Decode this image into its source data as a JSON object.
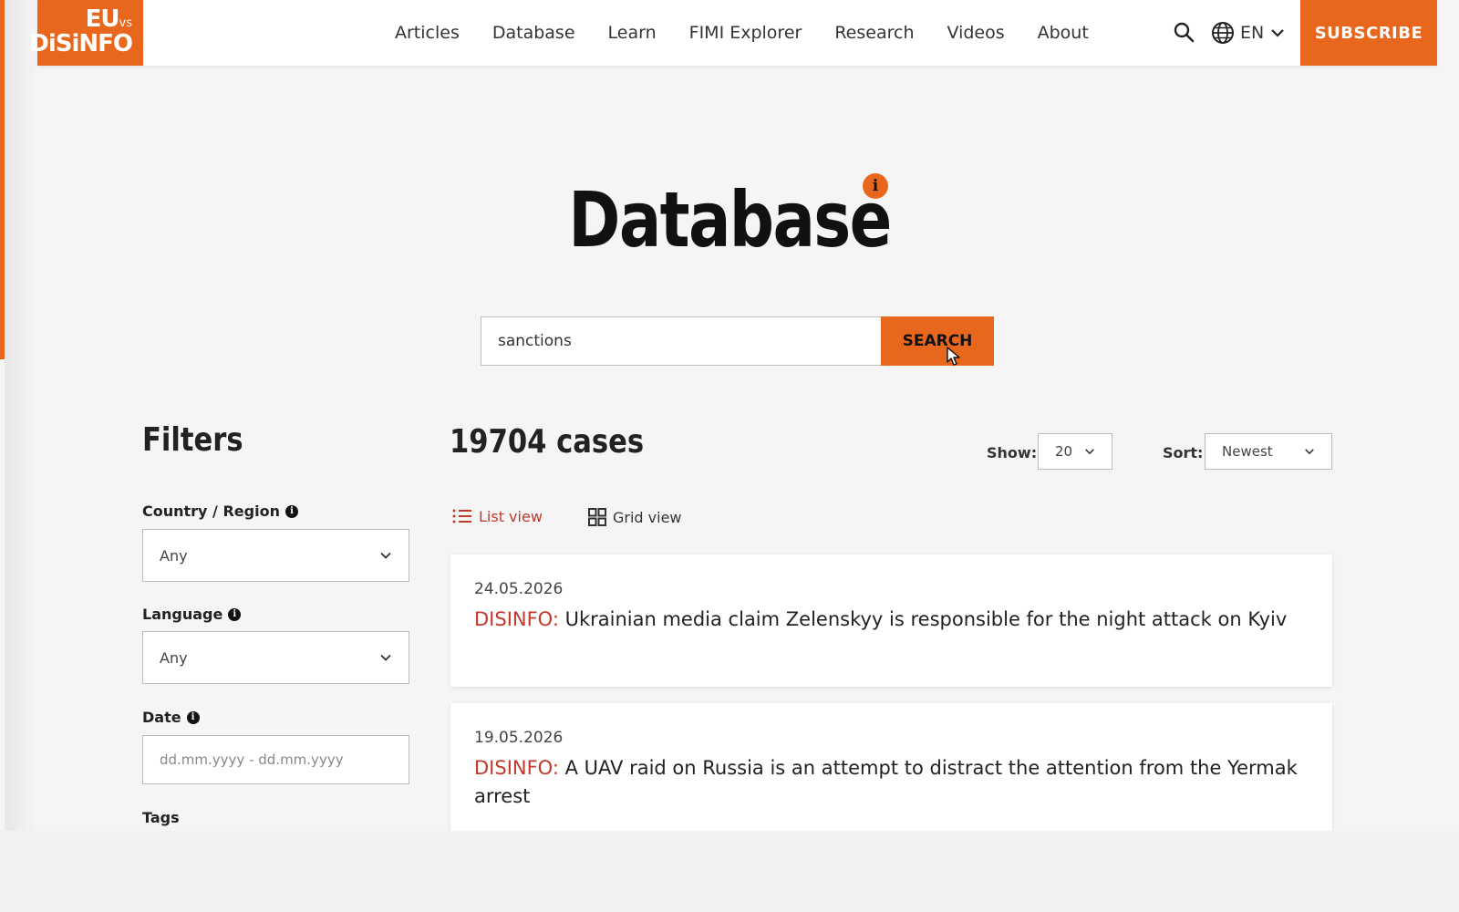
{
  "header": {
    "logo_line1": "EU",
    "logo_vs": "vs",
    "logo_line2": "DiSiNFO",
    "nav": [
      "Articles",
      "Database",
      "Learn",
      "FIMI Explorer",
      "Research",
      "Videos",
      "About"
    ],
    "language": "EN",
    "subscribe_label": "SUBSCRIBE"
  },
  "page": {
    "title": "Database",
    "info_badge": "i"
  },
  "search": {
    "value": "sanctions",
    "button_label": "SEARCH"
  },
  "filters": {
    "title": "Filters",
    "country_label": "Country / Region",
    "country_value": "Any",
    "language_label": "Language",
    "language_value": "Any",
    "date_label": "Date",
    "date_placeholder": "dd.mm.yyyy - dd.mm.yyyy",
    "tags_label": "Tags"
  },
  "results": {
    "count_text": "19704 cases",
    "show_label": "Show:",
    "show_value": "20",
    "sort_label": "Sort:",
    "sort_value": "Newest",
    "list_view_label": "List view",
    "grid_view_label": "Grid view",
    "cases": [
      {
        "date": "24.05.2026",
        "tag": "DISINFO:",
        "title": "Ukrainian media claim Zelenskyy is responsible for the night attack on Kyiv"
      },
      {
        "date": "19.05.2026",
        "tag": "DISINFO:",
        "title": "A UAV raid on Russia is an attempt to distract the attention from the Yermak arrest"
      }
    ]
  },
  "colors": {
    "brand_orange": "#e8671c",
    "disinfo_red": "#c0392b",
    "background": "#f5f5f5"
  },
  "icons": [
    "search-icon",
    "globe-icon",
    "chevron-down-icon",
    "info-icon",
    "list-icon",
    "grid-icon",
    "mouse-cursor-icon"
  ]
}
